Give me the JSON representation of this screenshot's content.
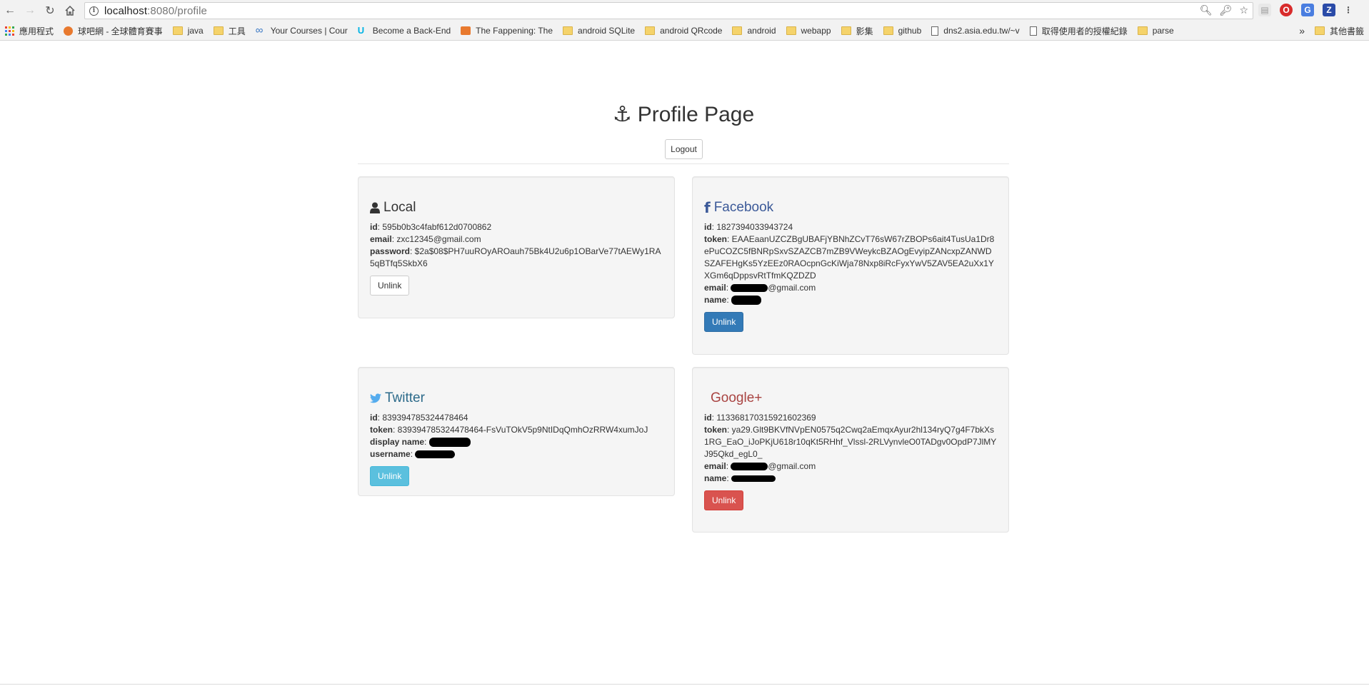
{
  "browser": {
    "url_host": "localhost",
    "url_path": ":8080/profile",
    "bookmarks": [
      {
        "label": "應用程式",
        "icon": "apps-icon"
      },
      {
        "label": "球吧網 - 全球體育賽事",
        "icon": "sports-site-icon"
      },
      {
        "label": "java",
        "icon": "folder-icon"
      },
      {
        "label": "工具",
        "icon": "folder-icon"
      },
      {
        "label": "Your Courses | Cour",
        "icon": "courses-icon"
      },
      {
        "label": "Become a Back-End",
        "icon": "udacity-icon"
      },
      {
        "label": "The Fappening: The",
        "icon": "site-icon"
      },
      {
        "label": "android SQLite",
        "icon": "folder-icon"
      },
      {
        "label": "android QRcode",
        "icon": "folder-icon"
      },
      {
        "label": "android",
        "icon": "folder-icon"
      },
      {
        "label": "webapp",
        "icon": "folder-icon"
      },
      {
        "label": "影集",
        "icon": "folder-icon"
      },
      {
        "label": "github",
        "icon": "folder-icon"
      },
      {
        "label": "dns2.asia.edu.tw/~v",
        "icon": "page-icon"
      },
      {
        "label": "取得使用者的授權紀錄",
        "icon": "page-icon"
      },
      {
        "label": "parse",
        "icon": "folder-icon"
      }
    ],
    "overflow_label": "»",
    "other_bookmarks": "其他書籤"
  },
  "page": {
    "title": "Profile Page",
    "logout_label": "Logout"
  },
  "local": {
    "title": "Local",
    "id_label": "id",
    "id": ": 595b0b3c4fabf612d0700862",
    "email_label": "email",
    "email": ": zxc12345@gmail.com",
    "password_label": "password",
    "password": ": $2a$08$PH7uuROyAROauh75Bk4U2u6p1OBarVe77tAEWy1RA5qBTfq5SkbX6",
    "unlink_label": "Unlink"
  },
  "facebook": {
    "title": "Facebook",
    "id_label": "id",
    "id": ": 1827394033943724",
    "token_label": "token",
    "token": ": EAAEaanUZCZBgUBAFjYBNhZCvT76sW67rZBOPs6ait4TusUa1Dr8ePuCOZC5fBNRpSxvSZAZCB7mZB9VWeykcBZAOgEvyipZANcxpZANWDSZAFEHgKs5YzEEz0RAOcpnGcKiWja78Nxp8iRcFyxYwV5ZAV5EA2uXx1YXGm6qDppsvRtTfmKQZDZD",
    "email_label": "email",
    "email_suffix": "@gmail.com",
    "name_label": "name",
    "unlink_label": "Unlink"
  },
  "twitter": {
    "title": "Twitter",
    "id_label": "id",
    "id": ": 839394785324478464",
    "token_label": "token",
    "token": ": 839394785324478464-FsVuTOkV5p9NtIDqQmhOzRRW4xumJoJ",
    "display_name_label": "display name",
    "username_label": "username",
    "unlink_label": "Unlink"
  },
  "google": {
    "title": "Google+",
    "id_label": "id",
    "id": ": 113368170315921602369",
    "token_label": "token",
    "token": ": ya29.Glt9BKVfNVpEN0575q2Cwq2aEmqxAyur2hl134ryQ7g4F7bkXs1RG_EaO_iJoPKjU618r10qKt5RHhf_Vlssl-2RLVynvleO0TADgv0OpdP7JlMYJ95Qkd_egL0_",
    "email_label": "email",
    "email_suffix": "@gmail.com",
    "name_label": "name",
    "unlink_label": "Unlink"
  },
  "colors": {
    "facebook": "#3b5998",
    "twitter": "#55acee",
    "google": "#a94442",
    "local": "#333333"
  }
}
